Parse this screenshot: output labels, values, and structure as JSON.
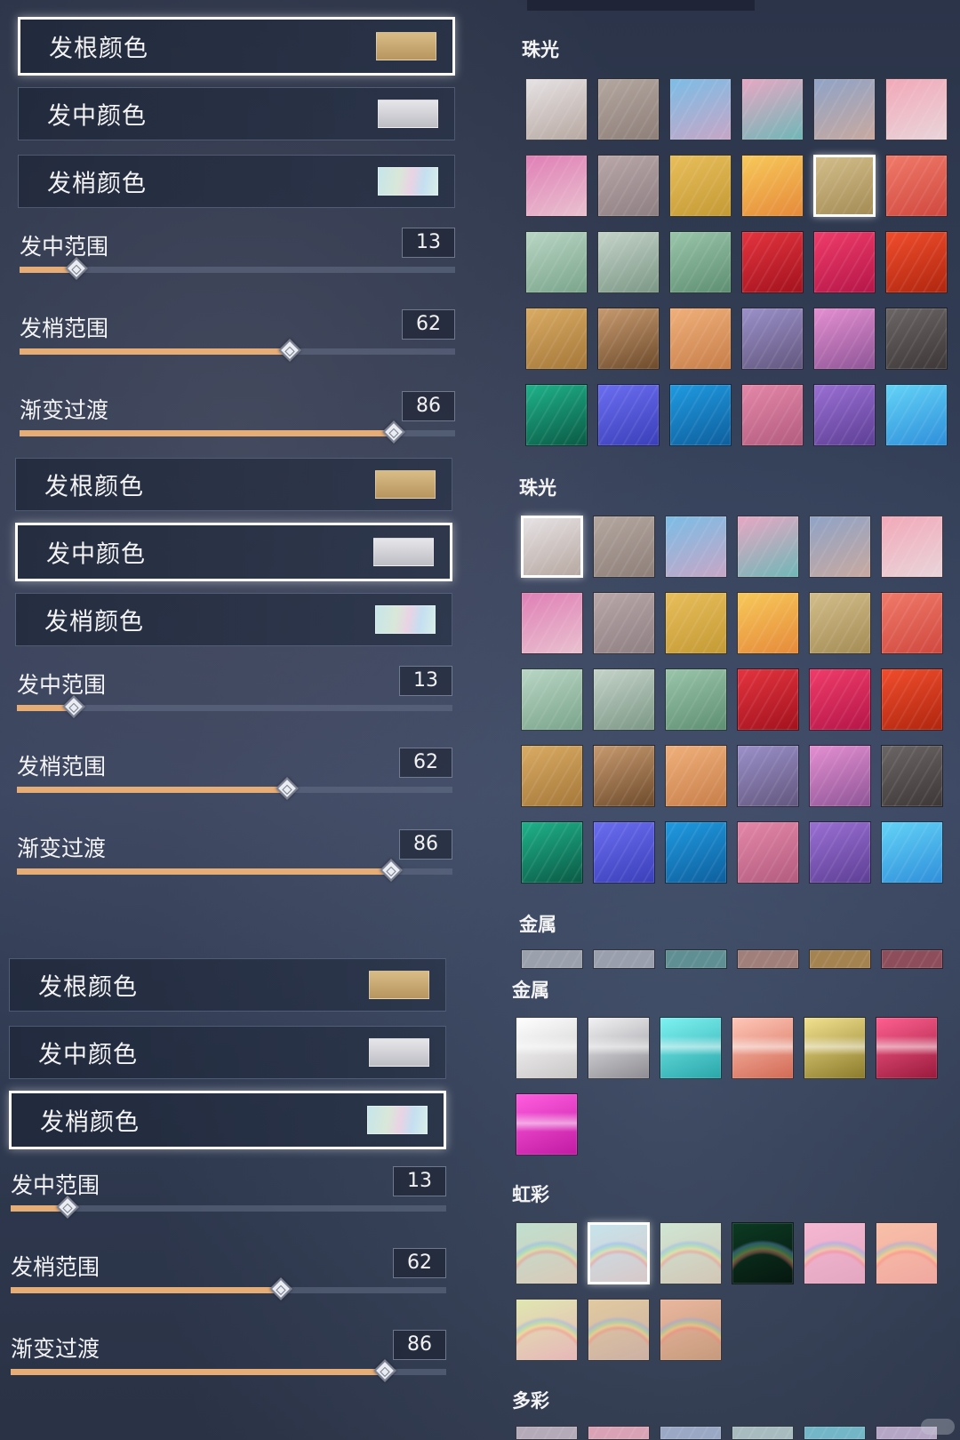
{
  "hair": {
    "sections": [
      {
        "colors": [
          {
            "label": "发根颜色",
            "swatch": "#c9a872",
            "selected": true
          },
          {
            "label": "发中颜色",
            "swatch": "#d2d2d6",
            "selected": false
          },
          {
            "label": "发梢颜色",
            "swatch": "#bfe3e6",
            "selected": false
          }
        ],
        "sliders": [
          {
            "label": "发中范围",
            "value": "13",
            "fraction": 0.13
          },
          {
            "label": "发梢范围",
            "value": "62",
            "fraction": 0.62
          },
          {
            "label": "渐变过渡",
            "value": "86",
            "fraction": 0.86
          }
        ]
      },
      {
        "colors": [
          {
            "label": "发根颜色",
            "swatch": "#c9a872",
            "selected": false
          },
          {
            "label": "发中颜色",
            "swatch": "#d2d2d6",
            "selected": true
          },
          {
            "label": "发梢颜色",
            "swatch": "#bfe3e6",
            "selected": false
          }
        ],
        "sliders": [
          {
            "label": "发中范围",
            "value": "13",
            "fraction": 0.13
          },
          {
            "label": "发梢范围",
            "value": "62",
            "fraction": 0.62
          },
          {
            "label": "渐变过渡",
            "value": "86",
            "fraction": 0.86
          }
        ]
      },
      {
        "colors": [
          {
            "label": "发根颜色",
            "swatch": "#c9a872",
            "selected": false
          },
          {
            "label": "发中颜色",
            "swatch": "#d2d2d6",
            "selected": false
          },
          {
            "label": "发梢颜色",
            "swatch": "#bfe3e6",
            "selected": true
          }
        ],
        "sliders": [
          {
            "label": "发中范围",
            "value": "13",
            "fraction": 0.13
          },
          {
            "label": "发梢范围",
            "value": "62",
            "fraction": 0.62
          },
          {
            "label": "渐变过渡",
            "value": "86",
            "fraction": 0.86
          }
        ]
      }
    ]
  },
  "palette": {
    "pearl_title": "珠光",
    "pearl_title_2": "珠光",
    "metal_title": "金属",
    "metal_title_2": "金属",
    "rainbow_title": "虹彩",
    "multicolor_title": "多彩",
    "pearl_colors": [
      [
        "#e6e2e4",
        "#b7a8a1"
      ],
      [
        "#b4a7a0",
        "#8e7f79"
      ],
      [
        "#7bbde6",
        "#c7a6c6"
      ],
      [
        "#e7a7c3",
        "#6fb7b7"
      ],
      [
        "#8fa3c7",
        "#c8a9a0"
      ],
      [
        "#f2a8b8",
        "#e9d5da"
      ],
      [
        "#e07fb6",
        "#e9c1cf"
      ],
      [
        "#b9a7a9",
        "#8e7f82"
      ],
      [
        "#e8be5b",
        "#c49a35"
      ],
      [
        "#f7c95a",
        "#e68a3a"
      ],
      [
        "#d2bd8a",
        "#a58c55"
      ],
      [
        "#f07a6a",
        "#d0483f"
      ],
      [
        "#b9d6c4",
        "#7aa48b"
      ],
      [
        "#c5d3c9",
        "#7b9785"
      ],
      [
        "#9ac5aa",
        "#5e8f72"
      ],
      [
        "#e3343f",
        "#a3121d"
      ],
      [
        "#ef3c6a",
        "#b51648"
      ],
      [
        "#f04d2c",
        "#b0260f"
      ],
      [
        "#d9ab63",
        "#a5783a"
      ],
      [
        "#c79a6f",
        "#6e4b2c"
      ],
      [
        "#f0b07b",
        "#c77e49"
      ],
      [
        "#9b90c9",
        "#62577e"
      ],
      [
        "#e48fd1",
        "#8e5597"
      ],
      [
        "#6b6565",
        "#3d3837"
      ],
      [
        "#1fb28a",
        "#0a5a45"
      ],
      [
        "#6b6df0",
        "#3a3fb9"
      ],
      [
        "#1f9ae0",
        "#0e5f9d"
      ],
      [
        "#e487a8",
        "#b35c7e"
      ],
      [
        "#9a6fd3",
        "#5d3f95"
      ],
      [
        "#63d3f7",
        "#2f8fda"
      ]
    ],
    "pearl_selected_1": 10,
    "pearl_selected_2": 0,
    "metal_partial": [
      "#9ba0ad",
      "#9a9fad",
      "#5f8f93",
      "#a07f7a",
      "#a58350",
      "#8e4d5b"
    ],
    "metal_colors": [
      [
        "#ffffff",
        "#c9c6c6"
      ],
      [
        "#f2f2f4",
        "#8e8c92"
      ],
      [
        "#7ef2f2",
        "#2aa6a9"
      ],
      [
        "#ffc7b8",
        "#d26a55"
      ],
      [
        "#f2e28f",
        "#8c7b2a"
      ],
      [
        "#ff5f8f",
        "#9a1a3c"
      ],
      [
        "#ff5de0",
        "#c21aa3"
      ]
    ],
    "rainbow_colors": [
      [
        "#bfe0cf",
        "#d9c9b8"
      ],
      [
        "#c6e4ec",
        "#d8c8c9"
      ],
      [
        "#cfe6d4",
        "#d2c6b6"
      ],
      [
        "#0c3a22",
        "#061710"
      ],
      [
        "#f5b7d2",
        "#e3a7c1"
      ],
      [
        "#f8c0a8",
        "#f0a8a0"
      ],
      [
        "#dfe7b0",
        "#e7b7b8"
      ],
      [
        "#e1caa0",
        "#cdb0a4"
      ],
      [
        "#e9b79e",
        "#c79a7d"
      ]
    ],
    "rainbow_selected": 1,
    "multi_partial": [
      "#b4aab8",
      "#d9a3b5",
      "#9aa8c6",
      "#a8bcc0",
      "#72b6c7",
      "#b5a6c6"
    ]
  }
}
